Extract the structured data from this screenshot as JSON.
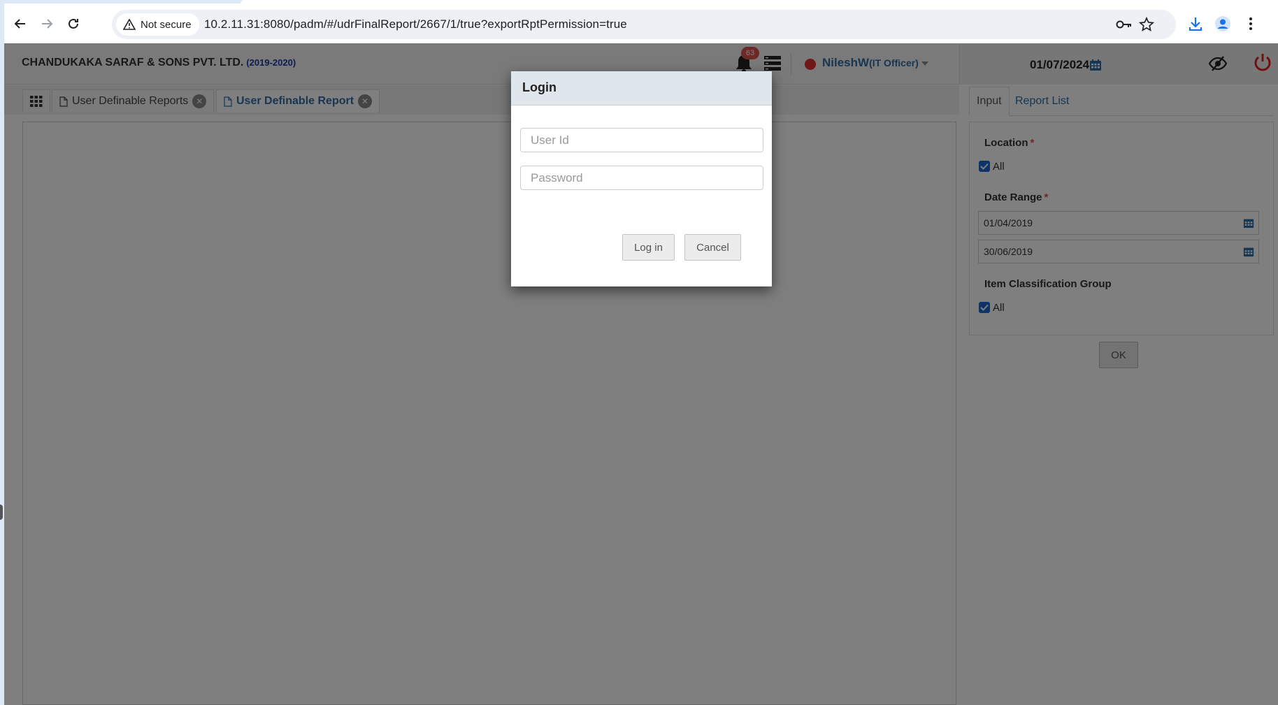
{
  "browser": {
    "security_label": "Not secure",
    "url": "10.2.11.31:8080/padm/#/udrFinalReport/2667/1/true?exportRptPermission=true"
  },
  "header": {
    "company": "CHANDUKAKA SARAF & SONS PVT. LTD.",
    "year": "(2019-2020)",
    "notification_count": "63",
    "user_name": "NileshW",
    "user_role": "(IT Officer)",
    "date": "01/07/2024"
  },
  "tabs": [
    {
      "label": "User Definable Reports",
      "active": false
    },
    {
      "label": "User Definable Report",
      "active": true
    }
  ],
  "right_panel": {
    "tabs": [
      {
        "label": "Input"
      },
      {
        "label": "Report List"
      }
    ],
    "location_label": "Location",
    "location_all": "All",
    "date_range_label": "Date Range",
    "date_from": "01/04/2019",
    "date_to": "30/06/2019",
    "item_group_label": "Item Classification Group",
    "item_group_all": "All",
    "ok_label": "OK",
    "required_mark": "*"
  },
  "modal": {
    "title": "Login",
    "user_placeholder": "User Id",
    "password_placeholder": "Password",
    "login_label": "Log in",
    "cancel_label": "Cancel"
  },
  "colors": {
    "link_blue": "#2e6da4",
    "year_blue": "#1a3aa8",
    "status_red": "#e03131",
    "checkbox_blue": "#1a66d0",
    "overlay": "rgba(0,0,0,0.5)"
  }
}
